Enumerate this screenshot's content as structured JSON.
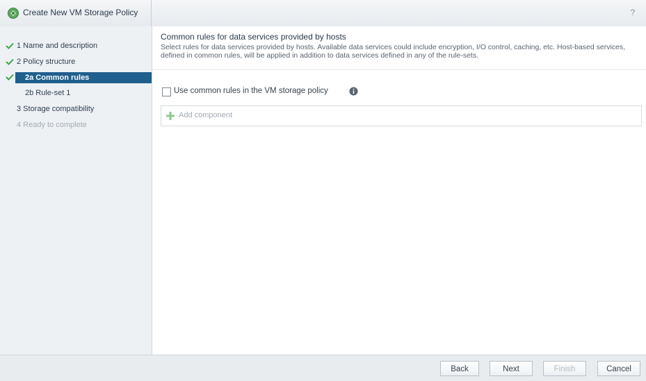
{
  "window": {
    "title": "Create New VM Storage Policy",
    "help_symbol": "?"
  },
  "nav": {
    "items": [
      {
        "label": "1  Name and description",
        "completed": true
      },
      {
        "label": "2  Policy structure",
        "completed": true
      },
      {
        "label": "2a  Common rules",
        "completed": true,
        "active": true
      },
      {
        "label": "2b  Rule-set 1",
        "completed": false
      },
      {
        "label": "3  Storage compatibility",
        "completed": false
      },
      {
        "label": "4  Ready to complete",
        "completed": false,
        "disabled": true
      }
    ]
  },
  "main": {
    "header_title": "Common rules for data services provided by hosts",
    "header_desc": "Select rules for data services provided by hosts. Available data services could include encryption, I/O control, caching, etc. Host-based services, defined in common rules, will be applied in addition to data services defined in any of the rule-sets.",
    "use_common_label": "Use common rules in the VM storage policy",
    "use_common_checked": false,
    "add_component_label": "Add component"
  },
  "footer": {
    "back_label": "Back",
    "next_label": "Next",
    "finish_label": "Finish",
    "cancel_label": "Cancel"
  },
  "colors": {
    "active_nav": "#1f5f8e",
    "check_green": "#3ea64a"
  }
}
